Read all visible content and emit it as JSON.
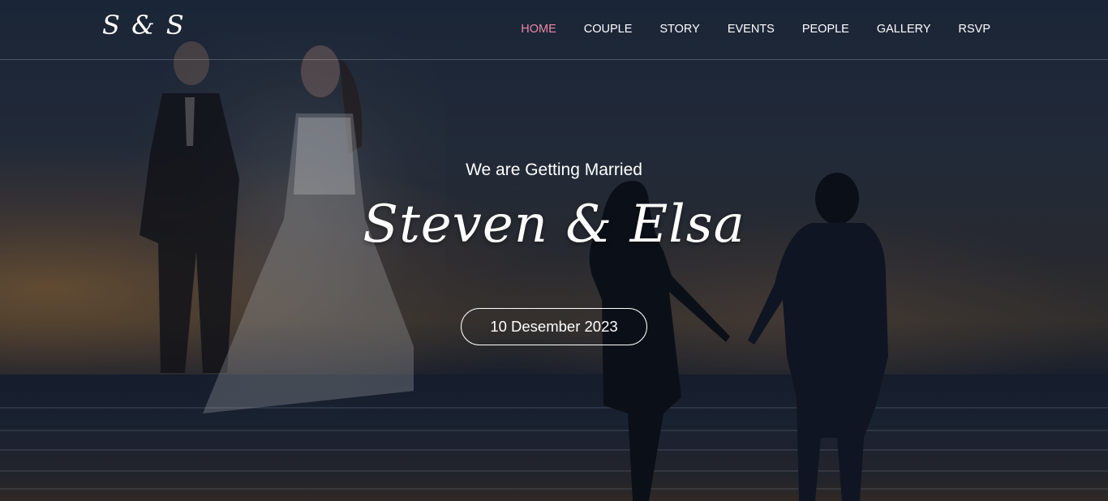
{
  "brand": {
    "logo_text": "S & S"
  },
  "nav": {
    "items": [
      {
        "label": "HOME",
        "active": true
      },
      {
        "label": "COUPLE",
        "active": false
      },
      {
        "label": "STORY",
        "active": false
      },
      {
        "label": "EVENTS",
        "active": false
      },
      {
        "label": "PEOPLE",
        "active": false
      },
      {
        "label": "GALLERY",
        "active": false
      },
      {
        "label": "RSVP",
        "active": false
      }
    ],
    "active_color": "#e98aa4",
    "text_color": "#ffffff"
  },
  "hero": {
    "tagline": "We are Getting Married",
    "names": "Steven & Elsa",
    "date_label": "10 Desember 2023"
  }
}
